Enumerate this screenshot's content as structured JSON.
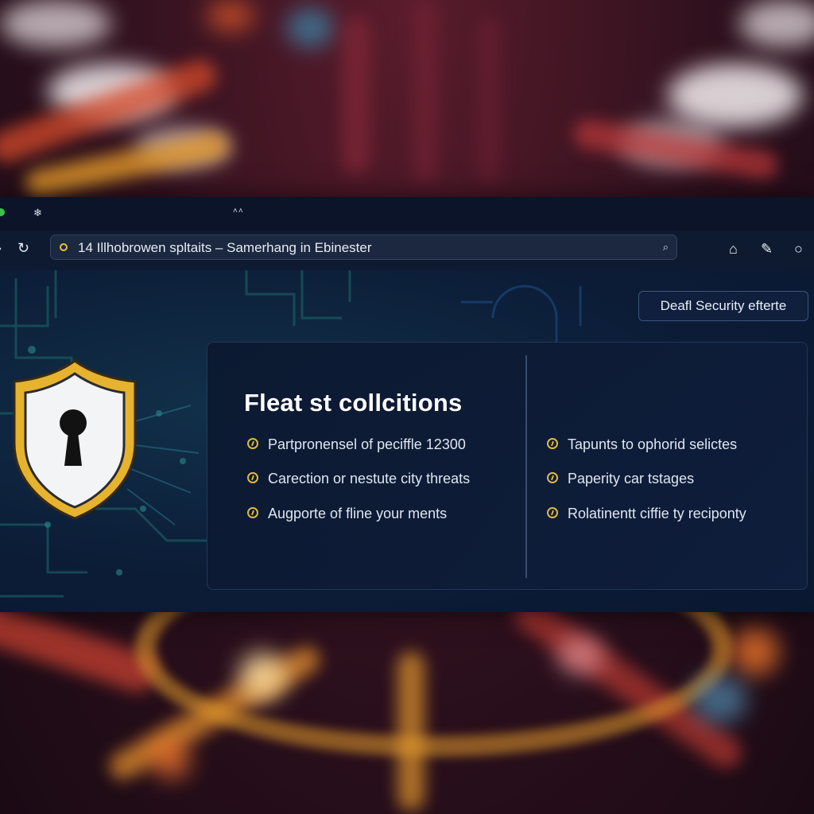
{
  "window": {
    "address_bar": {
      "text": "14 Illhobrowen spltaits – Samerhang in Ebinester"
    },
    "toolbar_icons": [
      "back-icon",
      "reload-icon",
      "search-icon",
      "home-icon",
      "pen-icon",
      "circle-icon"
    ]
  },
  "content": {
    "top_button": "Deafl Security efterte",
    "card": {
      "title": "Fleat st collcitions",
      "left_items": [
        "Partpronensel of peciffle 12300",
        "Carection or nestute city threats",
        "Augporte of fline your ments"
      ],
      "right_items": [
        "Tapunts to ophorid selictes",
        "Paperity car tstages",
        "Rolatinentt ciffie ty reciponty"
      ]
    }
  },
  "colors": {
    "accent_gold": "#e0b93a",
    "window_bg": "#0d1a33",
    "card_bg": "#0f1e3c",
    "text": "#dfe6f1"
  }
}
